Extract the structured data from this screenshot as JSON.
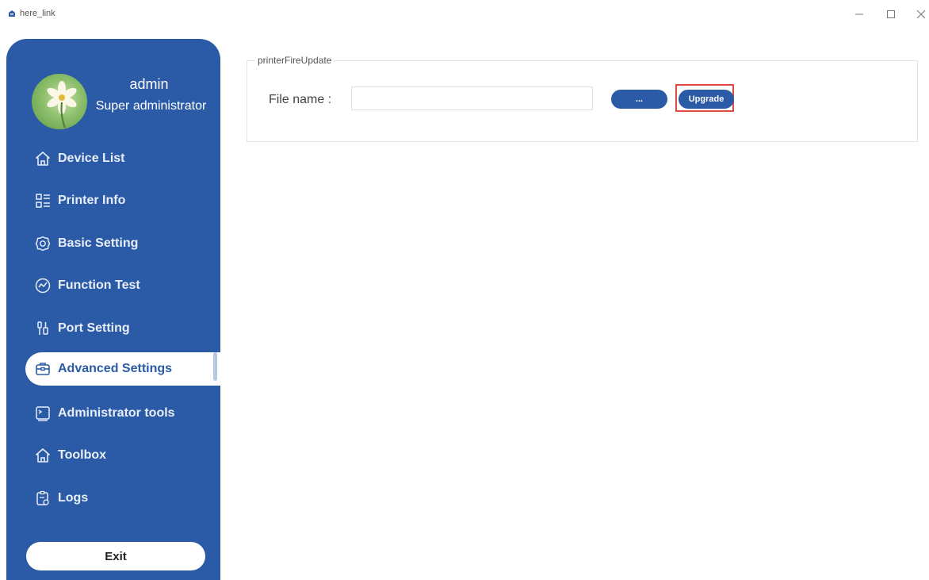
{
  "window": {
    "title": "here_link",
    "minimize_icon": "minimize-icon",
    "maximize_icon": "maximize-icon",
    "close_icon": "close-icon"
  },
  "user": {
    "name": "admin",
    "role": "Super administrator"
  },
  "sidebar": {
    "items": [
      {
        "label": "Device List",
        "icon": "home-icon",
        "active": false
      },
      {
        "label": "Printer Info",
        "icon": "list-icon",
        "active": false
      },
      {
        "label": "Basic Setting",
        "icon": "gear-icon",
        "active": false
      },
      {
        "label": "Function Test",
        "icon": "chart-icon",
        "active": false
      },
      {
        "label": "Port Setting",
        "icon": "plug-icon",
        "active": false
      },
      {
        "label": "Advanced Settings",
        "icon": "briefcase-icon",
        "active": true
      },
      {
        "label": "Administrator tools",
        "icon": "terminal-icon",
        "active": false
      },
      {
        "label": "Toolbox",
        "icon": "home-icon",
        "active": false
      },
      {
        "label": "Logs",
        "icon": "clipboard-icon",
        "active": false
      }
    ],
    "exit_label": "Exit"
  },
  "main": {
    "group_title": "printerFireUpdate",
    "file_label": "File name :",
    "file_value": "",
    "browse_label": "...",
    "upgrade_label": "Upgrade"
  },
  "colors": {
    "sidebar_bg": "#2b5ba6",
    "highlight_border": "#e04b3f"
  }
}
